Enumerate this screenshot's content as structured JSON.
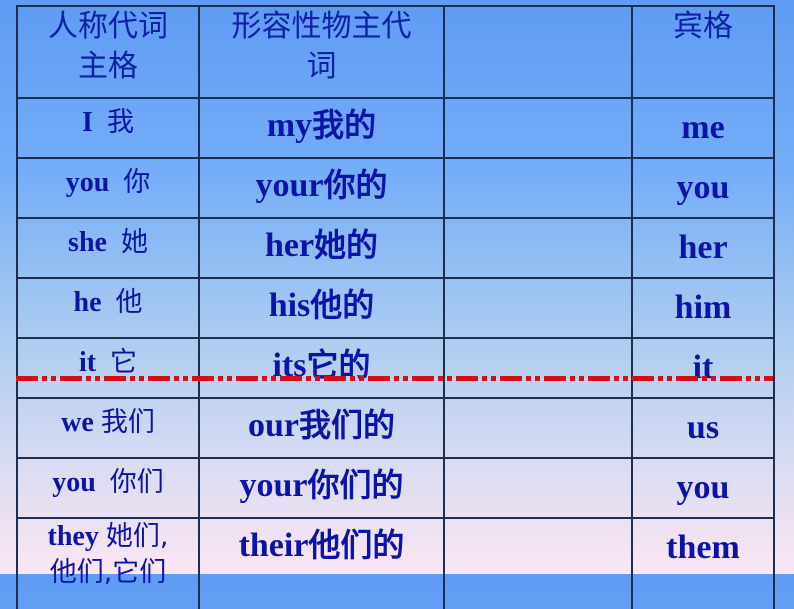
{
  "table": {
    "headers": {
      "subject_line1": "人称代词",
      "subject_line2": "主格",
      "possessive_line1": "形容性物主代",
      "possessive_line2": "词",
      "blank": "",
      "object": "宾格"
    },
    "rows": [
      {
        "subject_en": "I",
        "subject_zh": "我",
        "possessive_en": "my",
        "possessive_zh": "我的",
        "blank": "",
        "object": "me"
      },
      {
        "subject_en": "you",
        "subject_zh": "你",
        "possessive_en": "your",
        "possessive_zh": "你的",
        "blank": "",
        "object": "you"
      },
      {
        "subject_en": "she",
        "subject_zh": "她",
        "possessive_en": "her",
        "possessive_zh": "她的",
        "blank": "",
        "object": "her"
      },
      {
        "subject_en": "he",
        "subject_zh": "他",
        "possessive_en": "his",
        "possessive_zh": "他的",
        "blank": "",
        "object": "him"
      },
      {
        "subject_en": "it",
        "subject_zh": "它",
        "possessive_en": "its",
        "possessive_zh": "它的",
        "blank": "",
        "object": "it"
      },
      {
        "subject_en": "we",
        "subject_zh": "我们",
        "possessive_en": "our",
        "possessive_zh": "我们的",
        "blank": "",
        "object": "us"
      },
      {
        "subject_en": "you",
        "subject_zh": "你们",
        "possessive_en": "your",
        "possessive_zh": "你们的",
        "blank": "",
        "object": "you"
      },
      {
        "subject_en": "they",
        "subject_zh": "她们,",
        "subject_zh_line2": "他们,它们",
        "possessive_en": "their",
        "possessive_zh": "他们的",
        "blank": "",
        "object": "them"
      }
    ]
  },
  "colors": {
    "text": "#0c14a8",
    "border": "#1c2f52",
    "divider": "#d60f14",
    "background_top": "#5f9bf3",
    "background_bottom": "#fbe6f3"
  }
}
